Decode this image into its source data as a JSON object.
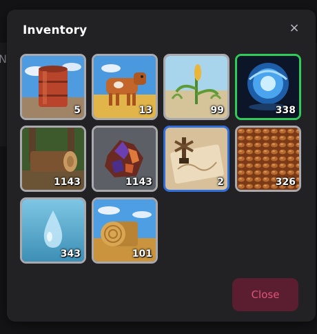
{
  "modal": {
    "title": "Inventory",
    "close_icon_glyph": "×",
    "close_button_label": "Close"
  },
  "backdrop": {
    "partial_text": "N"
  },
  "colors": {
    "selected_green": "#2ecc59",
    "selected_blue": "#2f6fe0",
    "slot_border": "#a9a9ae",
    "close_button_bg": "#5b1d30",
    "close_button_text": "#e0557a"
  },
  "inventory": {
    "items": [
      {
        "icon": "oil-barrel-icon",
        "count": "5"
      },
      {
        "icon": "cow-icon",
        "count": "13"
      },
      {
        "icon": "corn-plant-icon",
        "count": "99"
      },
      {
        "icon": "energy-orb-icon",
        "count": "338",
        "selected": "green"
      },
      {
        "icon": "wood-log-icon",
        "count": "1143"
      },
      {
        "icon": "ore-crystal-icon",
        "count": "1143"
      },
      {
        "icon": "treasure-map-icon",
        "count": "2",
        "selected": "blue"
      },
      {
        "icon": "grain-seeds-icon",
        "count": "326"
      },
      {
        "icon": "water-drop-icon",
        "count": "343"
      },
      {
        "icon": "hay-bale-icon",
        "count": "101"
      }
    ]
  }
}
